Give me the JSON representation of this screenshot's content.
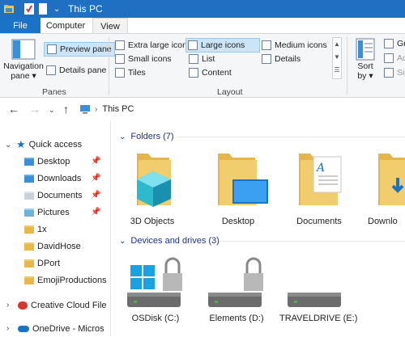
{
  "window": {
    "title": "This PC"
  },
  "tabs": {
    "file": "File",
    "computer": "Computer",
    "view": "View"
  },
  "ribbon": {
    "panes": {
      "label": "Panes",
      "navigation_pane": "Navigation",
      "navigation_pane_2": "pane",
      "preview_pane": "Preview pane",
      "details_pane": "Details pane"
    },
    "layout": {
      "label": "Layout",
      "extra_large_icons": "Extra large icons",
      "large_icons": "Large icons",
      "medium_icons": "Medium icons",
      "small_icons": "Small icons",
      "list": "List",
      "details": "Details",
      "tiles": "Tiles",
      "content": "Content"
    },
    "current_view": {
      "sort_by": "Sort",
      "sort_by_2": "by",
      "group_by": "Gro",
      "add_columns": "Ad",
      "size_columns": "Siz"
    }
  },
  "address": {
    "path": "This PC"
  },
  "nav": {
    "quick_access": "Quick access",
    "items": [
      {
        "label": "Desktop",
        "pinned": true
      },
      {
        "label": "Downloads",
        "pinned": true
      },
      {
        "label": "Documents",
        "pinned": true
      },
      {
        "label": "Pictures",
        "pinned": true
      },
      {
        "label": "1x",
        "pinned": false
      },
      {
        "label": "DavidHose",
        "pinned": false
      },
      {
        "label": "DPort",
        "pinned": false
      },
      {
        "label": "EmojiProductions",
        "pinned": false
      }
    ],
    "creative_cloud": "Creative Cloud File",
    "onedrive": "OneDrive - Micros"
  },
  "content": {
    "folders_header": "Folders (7)",
    "folders": [
      "3D Objects",
      "Desktop",
      "Documents",
      "Downlo"
    ],
    "drives_header": "Devices and drives (3)",
    "drives": [
      "OSDisk (C:)",
      "Elements (D:)",
      "TRAVELDRIVE (E:)"
    ]
  },
  "colors": {
    "titlebar": "#1f6fc2",
    "file_tab": "#1a73c7",
    "folder": "#e8b94a",
    "selected": "#cce4f7",
    "section_header": "#1e3287"
  }
}
